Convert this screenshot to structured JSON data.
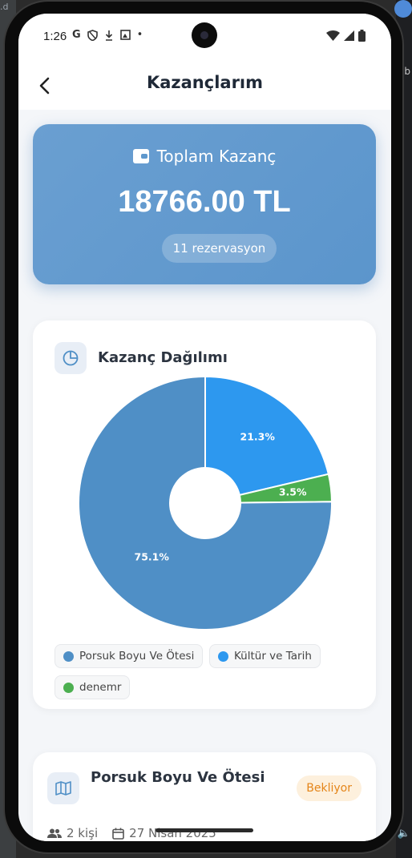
{
  "status_bar": {
    "time": "1:26",
    "icons": [
      "G",
      "shield-icon",
      "download-icon",
      "photo-icon",
      "•"
    ]
  },
  "header": {
    "title": "Kazançlarım"
  },
  "summary": {
    "label": "Toplam Kazanç",
    "amount": "18766.00 TL",
    "count": "11 rezervasyon"
  },
  "earnings_card": {
    "title": "Kazanç Dağılımı"
  },
  "chart_data": {
    "type": "pie",
    "labels": [
      "Porsuk Boyu Ve Ötesi",
      "Kültür ve Tarih",
      "denemr"
    ],
    "values": [
      75.1,
      21.3,
      3.5
    ],
    "value_labels": [
      "75.1%",
      "21.3%",
      "3.5%"
    ],
    "colors": [
      "#4f8fc6",
      "#2d98ef",
      "#4caf50"
    ],
    "donut": true
  },
  "legend": [
    {
      "label": "Porsuk Boyu Ve Ötesi",
      "color": "#4f8fc6"
    },
    {
      "label": "Kültür ve Tarih",
      "color": "#2d98ef"
    },
    {
      "label": "denemr",
      "color": "#4caf50"
    }
  ],
  "tour": {
    "name": "Porsuk Boyu Ve Ötesi",
    "status": "Bekliyor",
    "people": "2 kişi",
    "date": "27 Nisan 2025"
  }
}
